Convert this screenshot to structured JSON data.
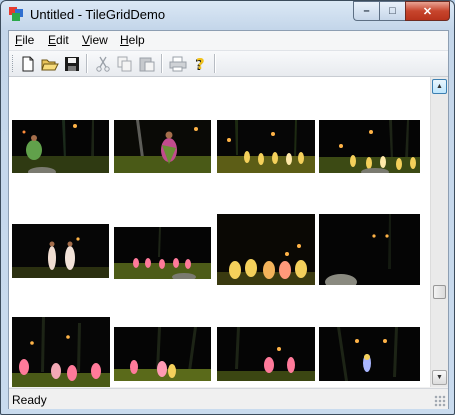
{
  "window": {
    "title": "Untitled - TileGridDemo",
    "minimize_label": "–",
    "maximize_label": "□",
    "close_label": "✕"
  },
  "menubar": {
    "items": [
      {
        "label": "File",
        "accel": "F"
      },
      {
        "label": "Edit",
        "accel": "E"
      },
      {
        "label": "View",
        "accel": "V"
      },
      {
        "label": "Help",
        "accel": "H"
      }
    ]
  },
  "toolbar": {
    "buttons": [
      {
        "icon": "new-document-icon",
        "enabled": true
      },
      {
        "icon": "open-folder-icon",
        "enabled": true
      },
      {
        "icon": "save-disk-icon",
        "enabled": true
      },
      {
        "icon": "cut-scissors-icon",
        "enabled": false
      },
      {
        "icon": "copy-icon",
        "enabled": false
      },
      {
        "icon": "paste-icon",
        "enabled": false
      },
      {
        "icon": "print-icon",
        "enabled": false
      },
      {
        "icon": "help-question-icon",
        "enabled": true
      }
    ]
  },
  "grid": {
    "columns": 4,
    "rows": 3,
    "tiles": [
      {
        "name": "tile-1-1",
        "scene": "dancer-green-skirt"
      },
      {
        "name": "tile-1-2",
        "scene": "dancer-pink-grass"
      },
      {
        "name": "tile-1-3",
        "scene": "group-dancers-torches"
      },
      {
        "name": "tile-1-4",
        "scene": "group-dancers-palms"
      },
      {
        "name": "tile-2-1",
        "scene": "two-dancers-white"
      },
      {
        "name": "tile-2-2",
        "scene": "line-dancers-stage"
      },
      {
        "name": "tile-2-3",
        "scene": "dancers-yellow-blur"
      },
      {
        "name": "tile-2-4",
        "scene": "dark-night-torch"
      },
      {
        "name": "tile-3-1",
        "scene": "dancers-pink-torches"
      },
      {
        "name": "tile-3-2",
        "scene": "dancers-pink-palms"
      },
      {
        "name": "tile-3-3",
        "scene": "dancers-pink-night"
      },
      {
        "name": "tile-3-4",
        "scene": "performer-blue-light"
      }
    ]
  },
  "scrollbar": {
    "up_arrow": "▲",
    "down_arrow": "▼"
  },
  "status": {
    "text": "Ready"
  },
  "colors": {
    "title_bar_top": "#dbe8f5",
    "close_button": "#c7452d",
    "grass": "#4a5a17",
    "night_sky": "#050505",
    "torch": "#ffb347",
    "dancer_pink": "#ff7a9a",
    "dancer_yellow": "#f4d05b"
  }
}
